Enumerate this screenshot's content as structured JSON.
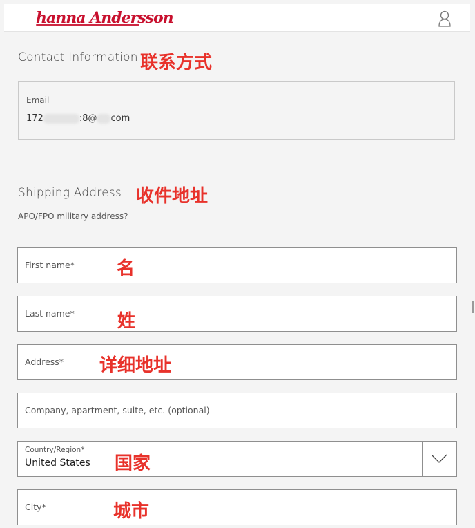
{
  "header": {
    "logo_text": "hanna Andersson",
    "account_icon": "person-outline-icon"
  },
  "contact": {
    "title": "Contact Information",
    "annotation": "联系方式",
    "email_label": "Email",
    "email_prefix": "172",
    "email_mid": ":8@",
    "email_suffix": "com"
  },
  "shipping": {
    "title": "Shipping Address",
    "annotation": "收件地址",
    "military_link": "APO/FPO military address?",
    "fields": {
      "first_name": {
        "label": "First name*",
        "annotation": "名"
      },
      "last_name": {
        "label": "Last name*",
        "annotation": "姓"
      },
      "address": {
        "label": "Address*",
        "annotation": "详细地址"
      },
      "company": {
        "label": "Company, apartment, suite, etc. (optional)"
      },
      "country": {
        "label": "Country/Region*",
        "value": "United States",
        "annotation": "国家",
        "icon": "chevron-down-icon"
      },
      "city": {
        "label": "City*",
        "annotation": "城市"
      }
    }
  },
  "colors": {
    "brand": "#c8102e",
    "annotation": "#e8322b",
    "border": "#8f8f8f"
  }
}
